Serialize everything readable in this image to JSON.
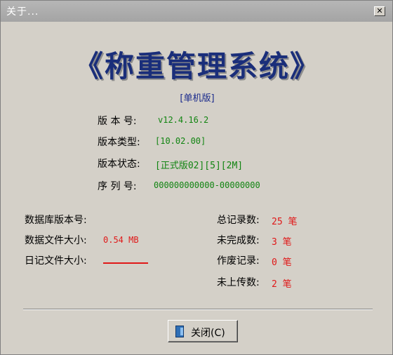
{
  "window": {
    "title": "关于..."
  },
  "header": {
    "app_title": "《称重管理系统》",
    "edition": "[单机版]"
  },
  "version_info": {
    "version_label": "版 本 号:",
    "version_value": "v12.4.16.2",
    "type_label": "版本类型:",
    "type_value": "[10.02.00]",
    "status_label": "版本状态:",
    "status_value": "[正式版02][5][2M]",
    "serial_label": "序 列 号:",
    "serial_value": "000000000000-00000000"
  },
  "file_info": {
    "db_version_label": "数据库版本号:",
    "db_version_value": "",
    "data_size_label": "数据文件大小:",
    "data_size_value": "0.54 MB",
    "log_size_label": "日记文件大小:"
  },
  "records": {
    "total_label": "总记录数:",
    "total_value": "25 笔",
    "unfinished_label": "未完成数:",
    "unfinished_value": "3 笔",
    "void_label": "作废记录:",
    "void_value": "0 笔",
    "not_uploaded_label": "未上传数:",
    "not_uploaded_value": "2 笔"
  },
  "buttons": {
    "close_label": "关闭(C)"
  },
  "icons": {
    "window_close": "close-icon",
    "close_button": "door-icon"
  },
  "colors": {
    "title_blue": "#1a2e7a",
    "value_green": "#118411",
    "value_red": "#e01818"
  }
}
